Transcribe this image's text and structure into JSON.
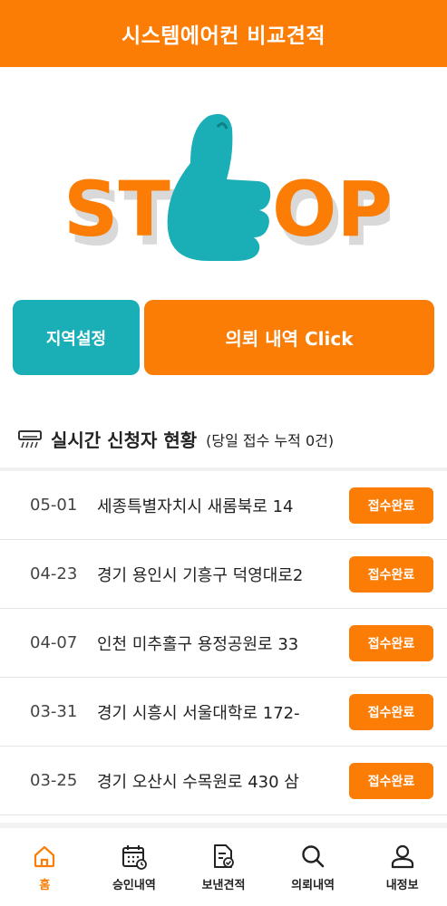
{
  "header": {
    "title": "시스템에어컨 비교견적"
  },
  "logo": {
    "left_text": "ST",
    "right_text": "OP"
  },
  "buttons": {
    "region": "지역설정",
    "request": "의뢰 내역 Click"
  },
  "section": {
    "title": "실시간 신청자 현황",
    "subtitle": "(당일 접수 누적 0건)"
  },
  "rows": [
    {
      "date": "05-01",
      "address": "세종특별자치시 새롬북로 14 ",
      "status": "접수완료"
    },
    {
      "date": "04-23",
      "address": "경기 용인시 기흥구 덕영대로2",
      "status": "접수완료"
    },
    {
      "date": "04-07",
      "address": "인천 미추홀구 용정공원로 33",
      "status": "접수완료"
    },
    {
      "date": "03-31",
      "address": "경기 시흥시 서울대학로 172-",
      "status": "접수완료"
    },
    {
      "date": "03-25",
      "address": "경기 오산시 수목원로 430 삼",
      "status": "접수완료"
    }
  ],
  "nav": [
    {
      "label": "홈",
      "icon": "home-icon",
      "active": true
    },
    {
      "label": "승인내역",
      "icon": "calendar-icon",
      "active": false
    },
    {
      "label": "보낸견적",
      "icon": "document-check-icon",
      "active": false
    },
    {
      "label": "의뢰내역",
      "icon": "search-icon",
      "active": false
    },
    {
      "label": "내정보",
      "icon": "user-icon",
      "active": false
    }
  ],
  "colors": {
    "accent": "#fb7d06",
    "teal": "#1aaeb6"
  }
}
